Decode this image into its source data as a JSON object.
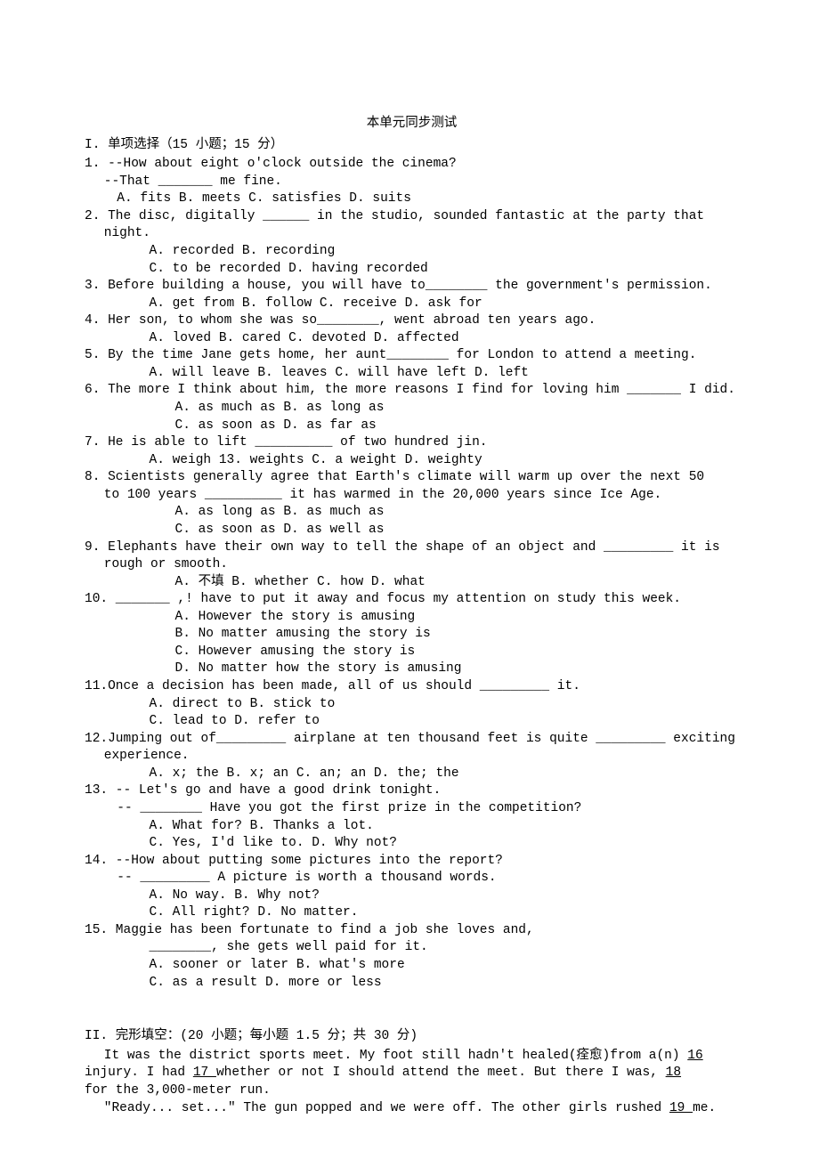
{
  "title": "本单元同步测试",
  "section1_header": "I. 单项选择（15 小题；15 分）",
  "q1": {
    "stem1": "1. --How about eight o'clock outside the cinema?",
    "stem2": "--That _______  me fine.",
    "opts": "A. fits      B. meets     C. satisfies     D. suits"
  },
  "q2": {
    "stem1": "2. The disc, digitally ______ in the studio, sounded fantastic at the party that",
    "stem2": "night.",
    "optsA": "A. recorded             B. recording",
    "optsB": "C. to be recorded        D. having recorded"
  },
  "q3": {
    "stem": "3. Before building a house, you will have to________ the government's permission.",
    "opts": "A. get from   B. follow   C. receive     D. ask for"
  },
  "q4": {
    "stem": "4. Her son, to whom she was so________, went abroad ten years ago.",
    "opts": "A. loved     B. cared    C. devoted    D. affected"
  },
  "q5": {
    "stem": "5. By the time Jane gets home, her aunt________ for London to attend a meeting.",
    "opts": "A. will leave   B. leaves   C. will have left D. left"
  },
  "q6": {
    "stem": "6. The more I think about him, the more reasons I find for loving him _______ I did.",
    "optsA": "A. as much as          B. as long as",
    "optsB": "C. as soon as           D. as far as"
  },
  "q7": {
    "stem": "7. He is able to lift __________ of two hundred jin.",
    "opts": "A. weigh     13. weights  C. a weight     D. weighty"
  },
  "q8": {
    "stem1": "8. Scientists generally agree that Earth's climate will warm up over the next 50",
    "stem2": "to 100 years __________ it has warmed in the 20,000 years since Ice Age.",
    "optsA": "A. as long as            B. as much as",
    "optsB": "C. as soon as             D. as well as"
  },
  "q9": {
    "stem1": "9. Elephants have their own way to tell the shape of an object and _________ it is",
    "stem2": "rough or smooth.",
    "opts": "A. 不填      B. whether   C. how      D. what"
  },
  "q10": {
    "stem": "10. _______ ,! have to put it away and focus my attention on study this week.",
    "optA": "A. However the story is amusing",
    "optB": "B. No matter amusing the story is",
    "optC": "C. However amusing the story is",
    "optD": "D. No matter how the story is amusing"
  },
  "q11": {
    "stem": "11.Once a decision has been made, all of us should _________ it.",
    "optsA": "A. direct to           B. stick to",
    "optsB": "C. lead to            D. refer to"
  },
  "q12": {
    "stem1": "12.Jumping out of_________ airplane at ten thousand feet is quite _________ exciting",
    "stem2": "experience.",
    "opts": "A. x; the    B. x; an    C. an; an    D. the; the"
  },
  "q13": {
    "stem1": "13. -- Let's go and have a good drink tonight.",
    "stem2": "-- ________ Have you got the first prize in the competition?",
    "optsA": "A. What for?           B. Thanks a lot.",
    "optsB": "C. Yes, I'd like to.      D. Why not?"
  },
  "q14": {
    "stem1": "14. --How about putting some pictures into the report?",
    "stem2": "-- _________ A picture is worth a thousand words.",
    "optsA": "A. No way.             B. Why not?",
    "optsB": "C. All right?           D. No matter."
  },
  "q15": {
    "stem1": "15. Maggie has been fortunate to find a job she loves and,",
    "stem2": "________, she gets well paid for it.",
    "optsA": "A. sooner or later       B. what's more",
    "optsB": "C. as a result          D. more or less"
  },
  "section2_header": "II.  完形填空：(20 小题；每小题 1.5 分；共 30 分)",
  "p1a": "It was the district sports meet. My foot still hadn't healed(痊愈)from a(n) ",
  "p1a_blank": "  16 ",
  "p1b": "injury.  I had ",
  "p1b_blank": "   17  ",
  "p1c": " whether or not I should attend the meet. But there I was, ",
  "p1c_blank": " 18 ",
  "p1d": "for the 3,000-meter run.",
  "p2a": "\"Ready... set...\" The gun popped and we were off. The other girls rushed  ",
  "p2a_blank": "  19  ",
  "p2b": " me."
}
